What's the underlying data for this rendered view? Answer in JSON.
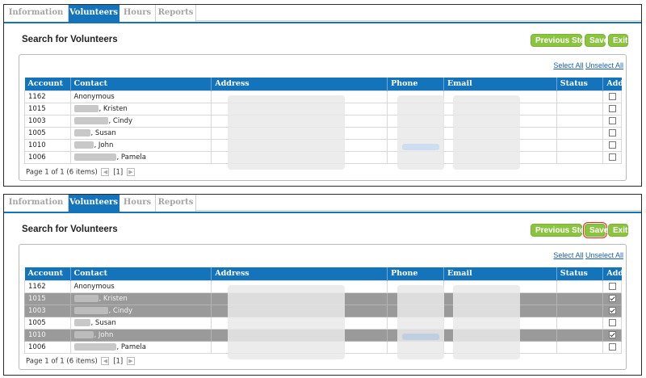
{
  "panels": [
    {
      "tabs": [
        "Information",
        "Volunteers",
        "Hours",
        "Reports"
      ],
      "title": "Search for Volunteers",
      "buttons": {
        "previous": "Previous Step",
        "save": "Save",
        "exit": "Exit"
      },
      "select_all": "Select All",
      "unselect_all": "Unselect All",
      "columns": [
        "Account",
        "Contact",
        "Address",
        "Phone",
        "Email",
        "Status",
        "Add"
      ],
      "rows": [
        {
          "account": "1162",
          "contact": "Anonymous",
          "checked": false,
          "selected": false
        },
        {
          "account": "1015",
          "contact": ", Kristen",
          "checked": false,
          "selected": false
        },
        {
          "account": "1003",
          "contact": ", Cindy",
          "checked": false,
          "selected": false
        },
        {
          "account": "1005",
          "contact": ", Susan",
          "checked": false,
          "selected": false
        },
        {
          "account": "1010",
          "contact": ", John",
          "checked": false,
          "selected": false
        },
        {
          "account": "1006",
          "contact": ", Pamela",
          "checked": false,
          "selected": false
        }
      ],
      "pager": {
        "summary": "Page 1 of 1 (6 items)",
        "current": "[1]"
      }
    },
    {
      "tabs": [
        "Information",
        "Volunteers",
        "Hours",
        "Reports"
      ],
      "title": "Search for Volunteers",
      "buttons": {
        "previous": "Previous Step",
        "save": "Save",
        "exit": "Exit"
      },
      "select_all": "Select All",
      "unselect_all": "Unselect All",
      "columns": [
        "Account",
        "Contact",
        "Address",
        "Phone",
        "Email",
        "Status",
        "Add"
      ],
      "rows": [
        {
          "account": "1162",
          "contact": "Anonymous",
          "checked": false,
          "selected": false
        },
        {
          "account": "1015",
          "contact": ", Kristen",
          "checked": true,
          "selected": true
        },
        {
          "account": "1003",
          "contact": ", Cindy",
          "checked": true,
          "selected": true
        },
        {
          "account": "1005",
          "contact": ", Susan",
          "checked": false,
          "selected": false
        },
        {
          "account": "1010",
          "contact": ", John",
          "checked": true,
          "selected": true
        },
        {
          "account": "1006",
          "contact": ", Pamela",
          "checked": false,
          "selected": false
        }
      ],
      "pager": {
        "summary": "Page 1 of 1 (6 items)",
        "current": "[1]"
      }
    }
  ],
  "colors": {
    "tab_active": "#1373bb",
    "button_green": "#8bc43f",
    "row_selected": "#9a9a9a",
    "callout_arrow": "#e02020"
  },
  "icons": {
    "pager_prev": "chevron-left-icon",
    "pager_next": "chevron-right-icon",
    "checkbox": "checkbox-icon",
    "callout": "red-arrow-icon"
  }
}
